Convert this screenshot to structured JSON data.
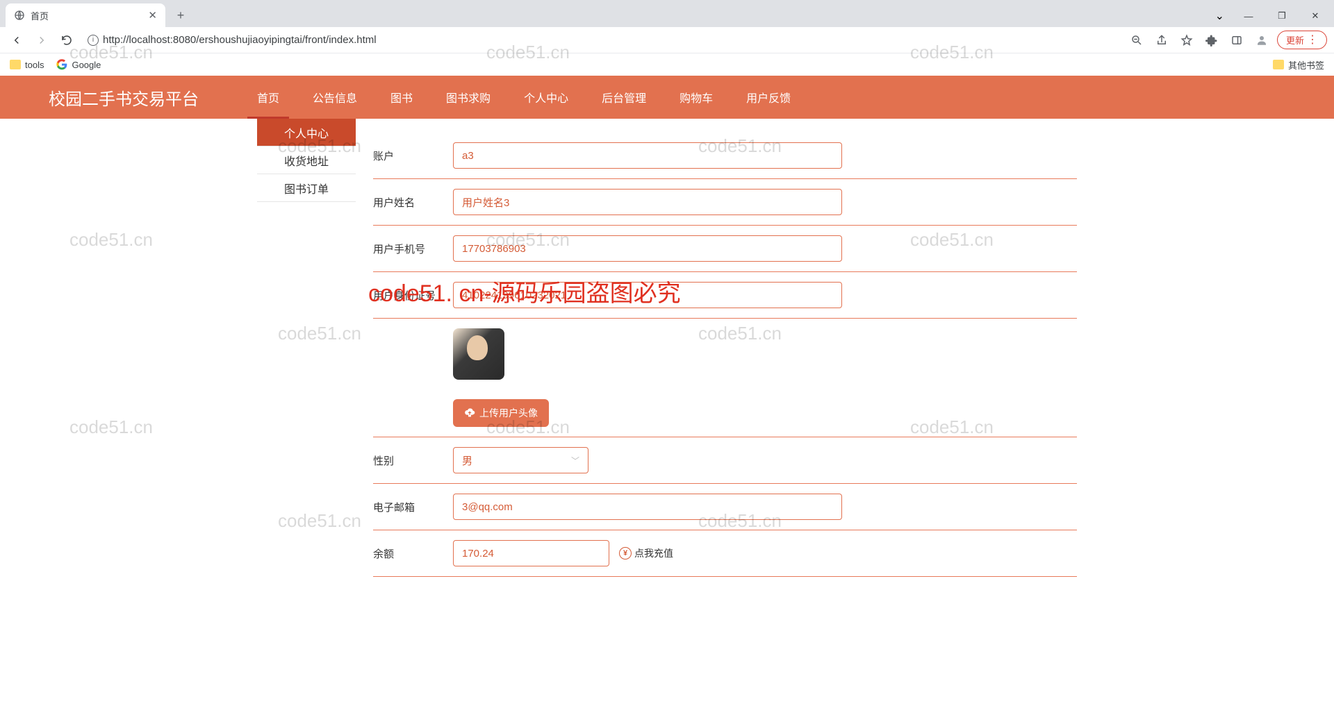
{
  "browser": {
    "tab_title": "首页",
    "url": "http://localhost:8080/ershoushujiaoyipingtai/front/index.html",
    "update_label": "更新",
    "bookmarks": {
      "tools": "tools",
      "google": "Google",
      "other": "其他书签"
    }
  },
  "header": {
    "logo": "校园二手书交易平台",
    "nav": [
      "首页",
      "公告信息",
      "图书",
      "图书求购",
      "个人中心",
      "后台管理",
      "购物车",
      "用户反馈"
    ]
  },
  "sidebar": {
    "items": [
      "个人中心",
      "收货地址",
      "图书订单"
    ]
  },
  "form": {
    "account_label": "账户",
    "account_value": "a3",
    "name_label": "用户姓名",
    "name_value": "用户姓名3",
    "phone_label": "用户手机号",
    "phone_value": "17703786903",
    "idcard_label": "用户身份证号",
    "idcard_value": "410224199610232021",
    "upload_label": "上传用户头像",
    "gender_label": "性别",
    "gender_value": "男",
    "email_label": "电子邮箱",
    "email_value": "3@qq.com",
    "balance_label": "余额",
    "balance_value": "170.24",
    "recharge_label": "点我充值"
  },
  "watermark": {
    "text": "code51.cn",
    "red": "code51. cn-源码乐园盗图必究"
  }
}
